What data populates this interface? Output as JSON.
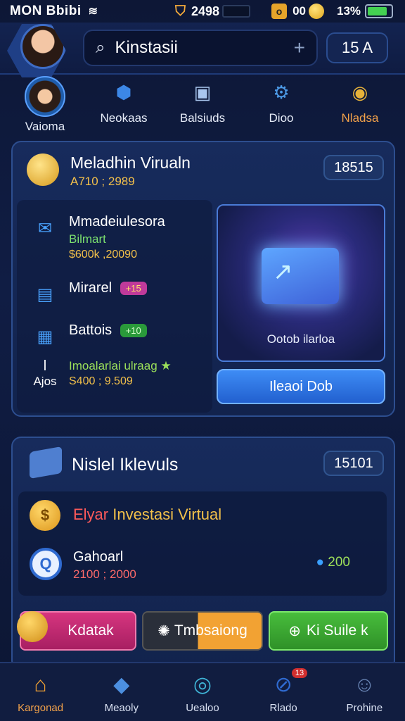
{
  "status_bar": {
    "carrier": "MON Bbibi",
    "mid_value": "2498",
    "gold_value": "00",
    "battery_pct": "13%",
    "battery_level": 0.85
  },
  "header": {
    "search_text": "Kinstasii",
    "count": "15 A"
  },
  "categories": [
    {
      "label": "Vaioma",
      "icon": "friends-icon"
    },
    {
      "label": "Neokaas",
      "icon": "hex-icon"
    },
    {
      "label": "Balsiuds",
      "icon": "box-icon"
    },
    {
      "label": "Dioo",
      "icon": "gear-icon"
    },
    {
      "label": "Nladsa",
      "icon": "coins-icon",
      "active": true
    }
  ],
  "panel1": {
    "title": "Meladhin Virualn",
    "subtitle": "A710 ; 2989",
    "badge": "18515",
    "rows": [
      {
        "t1": "Mmadeiulesora",
        "t2": "Bilmart",
        "t3": "$600k ,20090"
      },
      {
        "t1": "Mirarel",
        "pill": "+15"
      },
      {
        "t1": "Battois",
        "pill": "+10"
      },
      {
        "t1": "Imoalarlai ulraag ★",
        "t2": "S400 ; 9.509",
        "ajos": "Ajos"
      }
    ],
    "card_caption": "Ootob ilarloa",
    "button": "Ileaoi Dob"
  },
  "panel2": {
    "title": "Nislel Iklevuls",
    "badge": "15101",
    "invest_title_hl": "Elyar",
    "invest_title": " Investasi Virtual",
    "item_name": "Gahoarl",
    "item_range": "2100 ; 2000",
    "item_value": "200",
    "buttons": [
      "Kdatak",
      "Tmbsaiong",
      "Ki Suile k"
    ]
  },
  "bottom_nav": [
    {
      "label": "Kargonad",
      "icon": "home-icon",
      "active": true
    },
    {
      "label": "Meaoly",
      "icon": "layers-icon"
    },
    {
      "label": "Uealoo",
      "icon": "target-icon"
    },
    {
      "label": "Rlado",
      "icon": "compass-icon",
      "badge": "13"
    },
    {
      "label": "Prohine",
      "icon": "profile-icon"
    }
  ],
  "colors": {
    "accent_orange": "#f3a24a",
    "primary_blue": "#2260cf",
    "gold": "#f2c04a",
    "success_green": "#48bd3c",
    "magenta": "#d6357f"
  }
}
